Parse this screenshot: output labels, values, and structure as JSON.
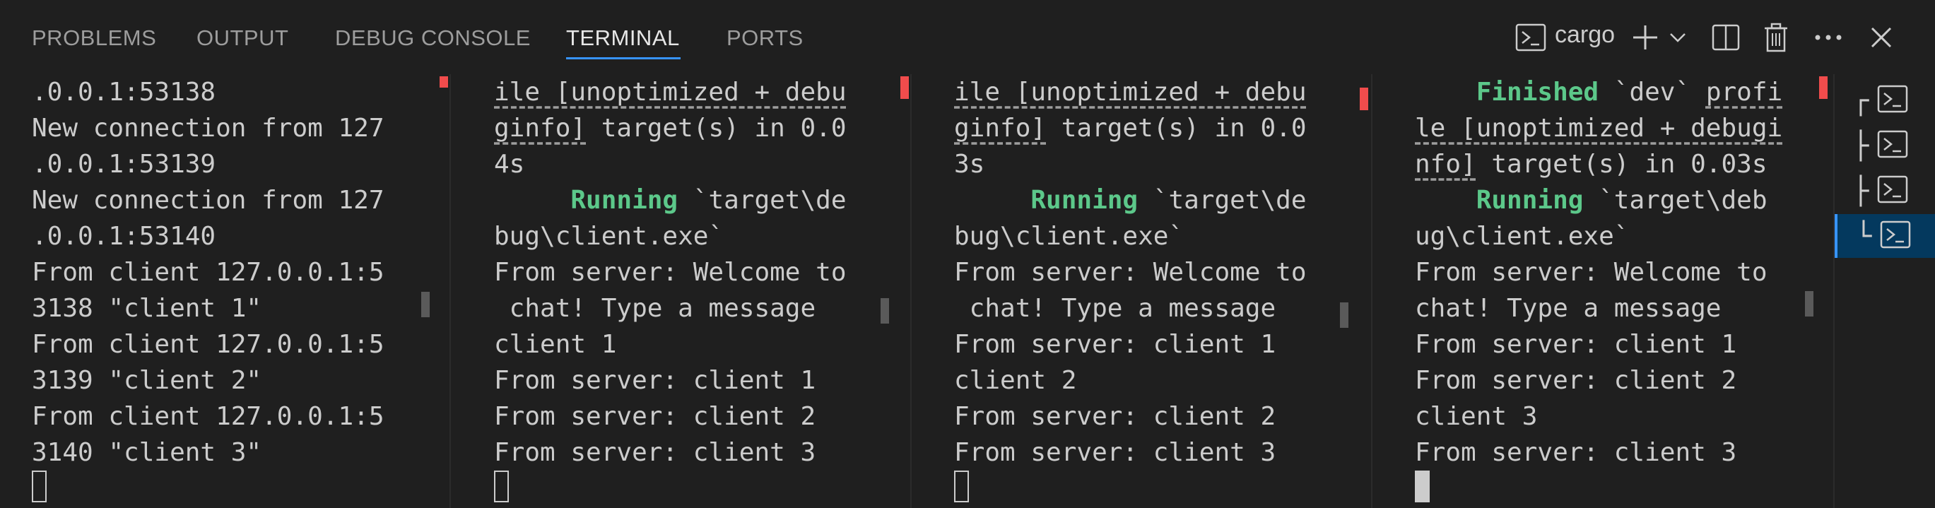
{
  "tabs": [
    "PROBLEMS",
    "OUTPUT",
    "DEBUG CONSOLE",
    "TERMINAL",
    "PORTS"
  ],
  "active_tab": "TERMINAL",
  "terminal_label": "cargo",
  "icons": {
    "terminal": "terminal-icon",
    "new": "plus-icon",
    "dropdown": "chevron-down-icon",
    "split": "split-icon",
    "kill": "trash-icon",
    "more": "ellipsis-icon",
    "close": "close-icon"
  },
  "colors": {
    "accent": "#3794ff",
    "success": "#5cc88a",
    "marker": "#f14c4c"
  },
  "panes": [
    {
      "lines": [
        [
          {
            "t": ".0.0.1:53138"
          }
        ],
        [
          {
            "t": "New connection from 127"
          }
        ],
        [
          {
            "t": ".0.0.1:53139"
          }
        ],
        [
          {
            "t": "New connection from 127"
          }
        ],
        [
          {
            "t": ".0.0.1:53140"
          }
        ],
        [
          {
            "t": "From client 127.0.0.1:5"
          }
        ],
        [
          {
            "t": "3138 \"client 1\""
          }
        ],
        [
          {
            "t": "From client 127.0.0.1:5"
          }
        ],
        [
          {
            "t": "3139 \"client 2\""
          }
        ],
        [
          {
            "t": "From client 127.0.0.1:5"
          }
        ],
        [
          {
            "t": "3140 \"client 3\""
          }
        ]
      ],
      "cursor_filled": false
    },
    {
      "lines": [
        [
          {
            "t": "ile [unoptimized + debu",
            "c": "ul"
          }
        ],
        [
          {
            "t": "ginfo]",
            "c": "ul"
          },
          {
            "t": " target(s) in 0.0"
          }
        ],
        [
          {
            "t": "4s"
          }
        ],
        [
          {
            "t": "     "
          },
          {
            "t": "Running",
            "c": "grn"
          },
          {
            "t": " `target\\de"
          }
        ],
        [
          {
            "t": "bug\\client.exe`"
          }
        ],
        [
          {
            "t": "From server: Welcome to"
          }
        ],
        [
          {
            "t": " chat! Type a message"
          }
        ],
        [
          {
            "t": "client 1"
          }
        ],
        [
          {
            "t": "From server: client 1"
          }
        ],
        [
          {
            "t": "From server: client 2"
          }
        ],
        [
          {
            "t": "From server: client 3"
          }
        ]
      ],
      "cursor_filled": false
    },
    {
      "lines": [
        [
          {
            "t": "ile [unoptimized + debu",
            "c": "ul"
          }
        ],
        [
          {
            "t": "ginfo]",
            "c": "ul"
          },
          {
            "t": " target(s) in 0.0"
          }
        ],
        [
          {
            "t": "3s"
          }
        ],
        [
          {
            "t": "     "
          },
          {
            "t": "Running",
            "c": "grn"
          },
          {
            "t": " `target\\de"
          }
        ],
        [
          {
            "t": "bug\\client.exe`"
          }
        ],
        [
          {
            "t": "From server: Welcome to"
          }
        ],
        [
          {
            "t": " chat! Type a message"
          }
        ],
        [
          {
            "t": "From server: client 1"
          }
        ],
        [
          {
            "t": "client 2"
          }
        ],
        [
          {
            "t": "From server: client 2"
          }
        ],
        [
          {
            "t": "From server: client 3"
          }
        ]
      ],
      "cursor_filled": false
    },
    {
      "lines": [
        [
          {
            "t": "    "
          },
          {
            "t": "Finished",
            "c": "grn"
          },
          {
            "t": " `dev` "
          },
          {
            "t": "profi",
            "c": "ul"
          }
        ],
        [
          {
            "t": "le [unoptimized + debugi",
            "c": "ul"
          }
        ],
        [
          {
            "t": "nfo]",
            "c": "ul"
          },
          {
            "t": " target(s) in 0.03s"
          }
        ],
        [
          {
            "t": "    "
          },
          {
            "t": "Running",
            "c": "grn"
          },
          {
            "t": " `target\\deb"
          }
        ],
        [
          {
            "t": "ug\\client.exe`"
          }
        ],
        [
          {
            "t": "From server: Welcome to"
          }
        ],
        [
          {
            "t": "chat! Type a message"
          }
        ],
        [
          {
            "t": "From server: client 1"
          }
        ],
        [
          {
            "t": "From server: client 2"
          }
        ],
        [
          {
            "t": "client 3"
          }
        ],
        [
          {
            "t": "From server: client 3"
          }
        ]
      ],
      "cursor_filled": true
    }
  ],
  "terminal_list": [
    {
      "tree": "┌",
      "selected": false
    },
    {
      "tree": "├",
      "selected": false
    },
    {
      "tree": "├",
      "selected": false
    },
    {
      "tree": "└",
      "selected": true
    }
  ]
}
